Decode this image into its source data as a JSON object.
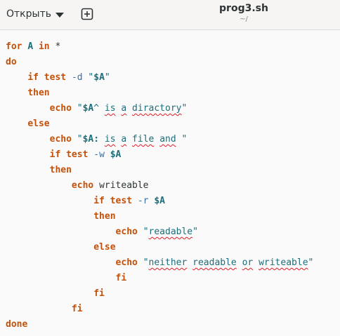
{
  "header": {
    "open_label": "Открыть",
    "file_name": "prog3.sh",
    "file_path": "~/"
  },
  "code": {
    "l1": {
      "a": "for",
      "b": "A",
      "c": "in",
      "d": "*"
    },
    "l2": {
      "a": "do"
    },
    "l3": {
      "a": "if",
      "b": "test",
      "c": "-d",
      "d": "\"",
      "e": "$A",
      "f": "\""
    },
    "l4": {
      "a": "then"
    },
    "l5": {
      "a": "echo",
      "b": "\"",
      "c": "$A",
      "d": "^ ",
      "e": "is",
      "f": " ",
      "g": "a",
      "h": " ",
      "i": "diractory",
      "j": "\""
    },
    "l6": {
      "a": "else"
    },
    "l7": {
      "a": "echo",
      "b": "\"",
      "c": "$A",
      "d": ": ",
      "e": "is",
      "f": " ",
      "g": "a",
      "h": " ",
      "i": "file",
      "j": " ",
      "k": "and",
      "l": " \""
    },
    "l8": {
      "a": "if",
      "b": "test",
      "c": "-w",
      "d": "$A"
    },
    "l9": {
      "a": "then"
    },
    "l10": {
      "a": "echo",
      "b": "writeable"
    },
    "l11": {
      "a": "if",
      "b": "test",
      "c": "-r",
      "d": "$A"
    },
    "l12": {
      "a": "then"
    },
    "l13": {
      "a": "echo",
      "b": "\"",
      "c": "readable",
      "d": "\""
    },
    "l14": {
      "a": "else"
    },
    "l15": {
      "a": "echo",
      "b": "\"",
      "c": "neither",
      "d": " ",
      "e": "readable",
      "f": " ",
      "g": "or",
      "h": " ",
      "i": "writeable",
      "j": "\""
    },
    "l16": {
      "a": "fi"
    },
    "l17": {
      "a": "fi"
    },
    "l18": {
      "a": "fi"
    },
    "l19": {
      "a": "done"
    }
  }
}
